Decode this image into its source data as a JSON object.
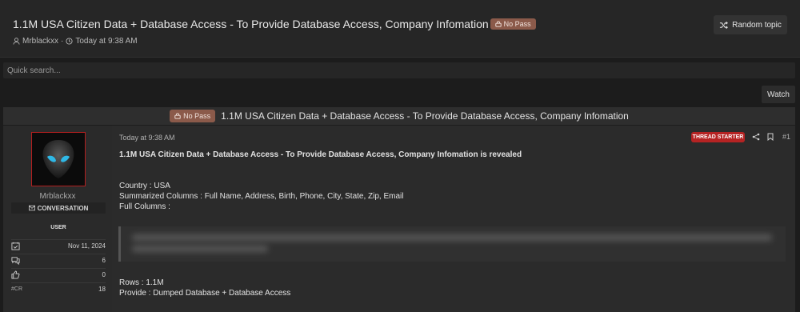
{
  "header": {
    "title": "1.1M USA Citizen Data + Database Access - To Provide Database Access, Company Infomation",
    "badge": "No Pass",
    "author": "Mrblackxx",
    "separator": "·",
    "date": "Today at 9:38 AM",
    "random_label": "Random topic"
  },
  "search": {
    "placeholder": "Quick search..."
  },
  "watch_label": "Watch",
  "post_title_bar": {
    "badge": "No Pass",
    "title": "1.1M USA Citizen Data + Database Access - To Provide Database Access, Company Infomation"
  },
  "user": {
    "name": "Mrblackxx",
    "conversation_label": "CONVERSATION",
    "role": "USER",
    "stats": {
      "joined": "Nov 11, 2024",
      "messages": "6",
      "reactions": "0",
      "cr_label": "#CR",
      "cr_value": "18"
    }
  },
  "post": {
    "date": "Today at 9:38 AM",
    "starter_label": "THREAD STARTER",
    "number": "#1",
    "intro": "1.1M USA Citizen Data + Database Access - To Provide Database Access, Company Infomation is revealed",
    "country": "Country : USA",
    "summarized": "Summarized Columns : Full Name, Address, Birth, Phone, City, State, Zip, Email",
    "full_columns": "Full Columns :",
    "rows": "Rows : 1.1M",
    "provide": "Provide : Dumped Database + Database Access"
  },
  "colors": {
    "accent_red": "#b52323",
    "nopass_badge": "#8b5a4a",
    "avatar_border": "#b21e1e",
    "alien_eyes": "#2fb8e6"
  }
}
